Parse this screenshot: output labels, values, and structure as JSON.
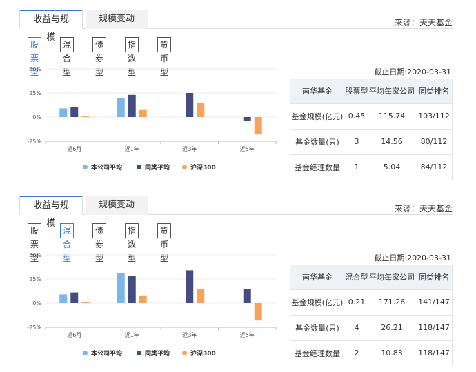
{
  "panels": [
    {
      "tabs": {
        "active": "收益与规模",
        "inactive": "规模变动"
      },
      "source": "来源：天天基金",
      "fund_types": [
        "股票型",
        "混合型",
        "债券型",
        "指数型",
        "货币型"
      ],
      "active_type_index": 0,
      "cutoff": "截止日期:2020-03-31",
      "table": {
        "headers": [
          "南华基金",
          "股票型",
          "平均每家公司",
          "同类排名"
        ],
        "rows": [
          [
            "基金规模(亿元)",
            "0.45",
            "115.74",
            "103/112"
          ],
          [
            "基金数量(只)",
            "3",
            "14.56",
            "80/112"
          ],
          [
            "基金经理数量",
            "1",
            "5.04",
            "84/112"
          ]
        ]
      },
      "chart_data": {
        "type": "bar",
        "categories": [
          "近6月",
          "近1年",
          "近3年",
          "近5年"
        ],
        "y_ticks": [
          "50%",
          "25%",
          "0%",
          "-25%"
        ],
        "ylim": [
          -25,
          50
        ],
        "series": [
          {
            "name": "本公司平均",
            "color": "#7cb5ec",
            "values": [
              9,
              20,
              null,
              null
            ]
          },
          {
            "name": "同类平均",
            "color": "#434d82",
            "values": [
              10,
              23,
              25,
              -4
            ]
          },
          {
            "name": "沪深300",
            "color": "#f7a35c",
            "values": [
              1,
              8,
              15,
              -18
            ]
          }
        ]
      }
    },
    {
      "tabs": {
        "active": "收益与规模",
        "inactive": "规模变动"
      },
      "source": "来源：天天基金",
      "fund_types": [
        "股票型",
        "混合型",
        "债券型",
        "指数型",
        "货币型"
      ],
      "active_type_index": 1,
      "cutoff": "截止日期:2020-03-31",
      "table": {
        "headers": [
          "南华基金",
          "混合型",
          "平均每家公司",
          "同类排名"
        ],
        "rows": [
          [
            "基金规模(亿元)",
            "0.21",
            "171.26",
            "141/147"
          ],
          [
            "基金数量(只)",
            "4",
            "26.21",
            "118/147"
          ],
          [
            "基金经理数量",
            "2",
            "10.83",
            "118/147"
          ]
        ]
      },
      "chart_data": {
        "type": "bar",
        "categories": [
          "近6月",
          "近1年",
          "近3年",
          "近5年"
        ],
        "y_ticks": [
          "50%",
          "25%",
          "0%",
          "-25%"
        ],
        "ylim": [
          -25,
          50
        ],
        "series": [
          {
            "name": "本公司平均",
            "color": "#7cb5ec",
            "values": [
              9,
              31,
              null,
              null
            ]
          },
          {
            "name": "同类平均",
            "color": "#434d82",
            "values": [
              11,
              28,
              34,
              15
            ]
          },
          {
            "name": "沪深300",
            "color": "#f7a35c",
            "values": [
              1,
              8,
              15,
              -18
            ]
          }
        ]
      }
    }
  ]
}
